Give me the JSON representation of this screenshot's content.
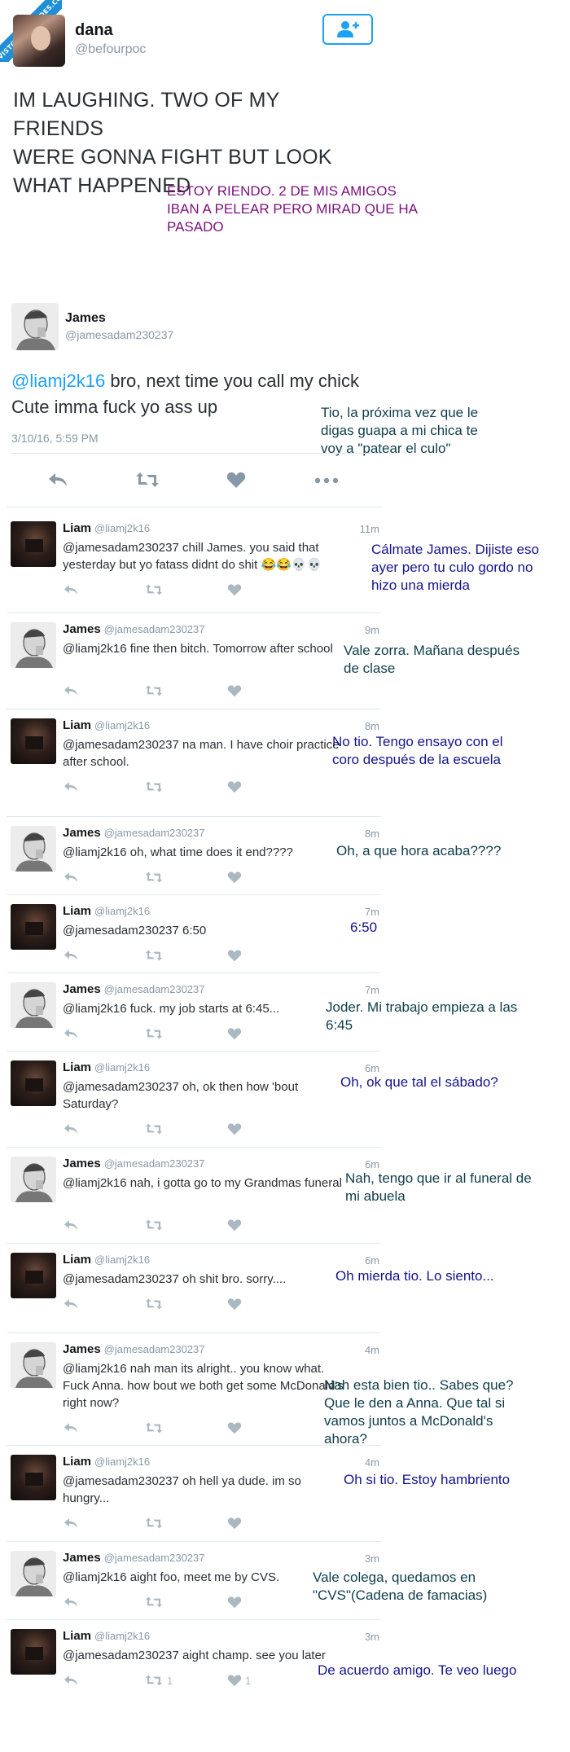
{
  "watermark": "VISTOENLASREDES.COM",
  "top": {
    "name": "dana",
    "handle": "@befourpoc",
    "tweet_lines": [
      "IM LAUGHING. TWO OF MY FRIENDS",
      "WERE GONNA FIGHT BUT LOOK",
      "WHAT HAPPENED"
    ],
    "translation_lines": [
      "ESTOY RIENDO. 2 DE MIS AMIGOS",
      "IBAN A PELEAR PERO MIRAD QUE HA",
      "PASADO"
    ]
  },
  "main": {
    "name": "James",
    "handle": "@jamesadam230237",
    "mention": "@liamj2k16",
    "text_rest": " bro, next time you call my chick Cute imma fuck yo ass up",
    "date": "3/10/16, 5:59 PM",
    "translation_lines": [
      "Tio, la próxima vez que le",
      "digas guapa a mi chica te",
      "voy a \"patear el culo\""
    ]
  },
  "replies": [
    {
      "name": "Liam",
      "handle": "@liamj2k16",
      "time": "11m",
      "text": "@jamesadam230237 chill James. you said that yesterday but yo fatass didnt do shit 😂😂💀💀",
      "translation": [
        "Cálmate James. Dijiste eso",
        "ayer pero tu culo gordo no",
        "hizo una mierda"
      ],
      "retweets": "",
      "likes": ""
    },
    {
      "name": "James",
      "handle": "@jamesadam230237",
      "time": "9m",
      "text": "@liamj2k16 fine then bitch. Tomorrow after school",
      "translation": [
        "Vale zorra. Mañana después",
        "de clase"
      ],
      "retweets": "",
      "likes": ""
    },
    {
      "name": "Liam",
      "handle": "@liamj2k16",
      "time": "8m",
      "text": "@jamesadam230237 na man. I have choir practice after school.",
      "translation": [
        "No tio. Tengo ensayo con el",
        "coro después de la escuela"
      ],
      "retweets": "",
      "likes": ""
    },
    {
      "name": "James",
      "handle": "@jamesadam230237",
      "time": "8m",
      "text": "@liamj2k16 oh, what time does it end????",
      "translation": [
        "Oh, a que hora acaba????"
      ],
      "retweets": "",
      "likes": ""
    },
    {
      "name": "Liam",
      "handle": "@liamj2k16",
      "time": "7m",
      "text": "@jamesadam230237 6:50",
      "translation": [
        "6:50"
      ],
      "retweets": "",
      "likes": ""
    },
    {
      "name": "James",
      "handle": "@jamesadam230237",
      "time": "7m",
      "text": "@liamj2k16 fuck. my job starts at 6:45...",
      "translation": [
        "Joder. Mi trabajo empieza a las",
        "6:45"
      ],
      "retweets": "",
      "likes": ""
    },
    {
      "name": "Liam",
      "handle": "@liamj2k16",
      "time": "6m",
      "text": "@jamesadam230237 oh, ok then how 'bout Saturday?",
      "translation": [
        "Oh, ok que tal el sábado?"
      ],
      "retweets": "",
      "likes": ""
    },
    {
      "name": "James",
      "handle": "@jamesadam230237",
      "time": "6m",
      "text": "@liamj2k16 nah, i gotta go to my Grandmas funeral",
      "translation": [
        "Nah, tengo que ir al funeral de",
        "mi abuela"
      ],
      "retweets": "",
      "likes": ""
    },
    {
      "name": "Liam",
      "handle": "@liamj2k16",
      "time": "6m",
      "text": "@jamesadam230237 oh shit bro. sorry....",
      "translation": [
        "Oh mierda tio. Lo siento..."
      ],
      "retweets": "",
      "likes": ""
    },
    {
      "name": "James",
      "handle": "@jamesadam230237",
      "time": "4m",
      "text": "@liamj2k16 nah man its alright.. you know what. Fuck Anna. how bout we both get some McDonald's right now?",
      "translation": [
        "Nah esta bien tio.. Sabes que?",
        "Que le den a Anna. Que tal si",
        "vamos juntos a McDonald's",
        "ahora?"
      ],
      "retweets": "",
      "likes": ""
    },
    {
      "name": "Liam",
      "handle": "@liamj2k16",
      "time": "4m",
      "text": "@jamesadam230237 oh hell ya dude. im so hungry...",
      "translation": [
        "Oh si tio. Estoy hambriento"
      ],
      "retweets": "",
      "likes": ""
    },
    {
      "name": "James",
      "handle": "@jamesadam230237",
      "time": "3m",
      "text": "@liamj2k16 aight foo, meet me by CVS.",
      "translation": [
        "Vale colega, quedamos en",
        "\"CVS\"(Cadena de famacias)"
      ],
      "retweets": "",
      "likes": ""
    },
    {
      "name": "Liam",
      "handle": "@liamj2k16",
      "time": "3m",
      "text": "@jamesadam230237 aight champ. see you later",
      "translation": [
        "De acuerdo amigo. Te veo luego"
      ],
      "retweets": "1",
      "likes": "1"
    }
  ]
}
